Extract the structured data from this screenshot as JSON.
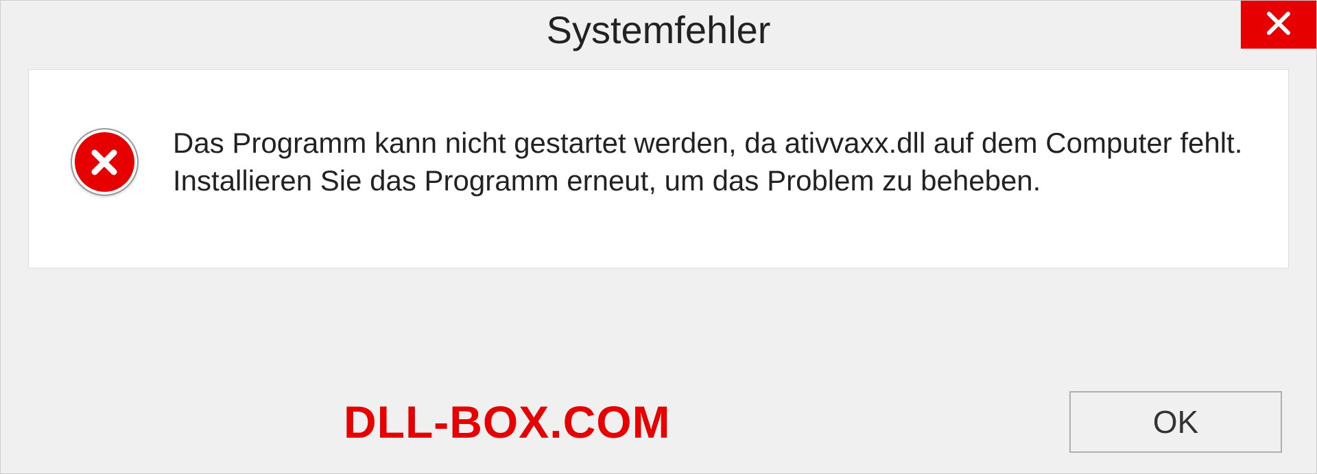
{
  "dialog": {
    "title": "Systemfehler",
    "message": "Das Programm kann nicht gestartet werden, da ativvaxx.dll auf dem Computer fehlt. Installieren Sie das Programm erneut, um das Problem zu beheben.",
    "ok_label": "OK"
  },
  "watermark": "DLL-BOX.COM"
}
